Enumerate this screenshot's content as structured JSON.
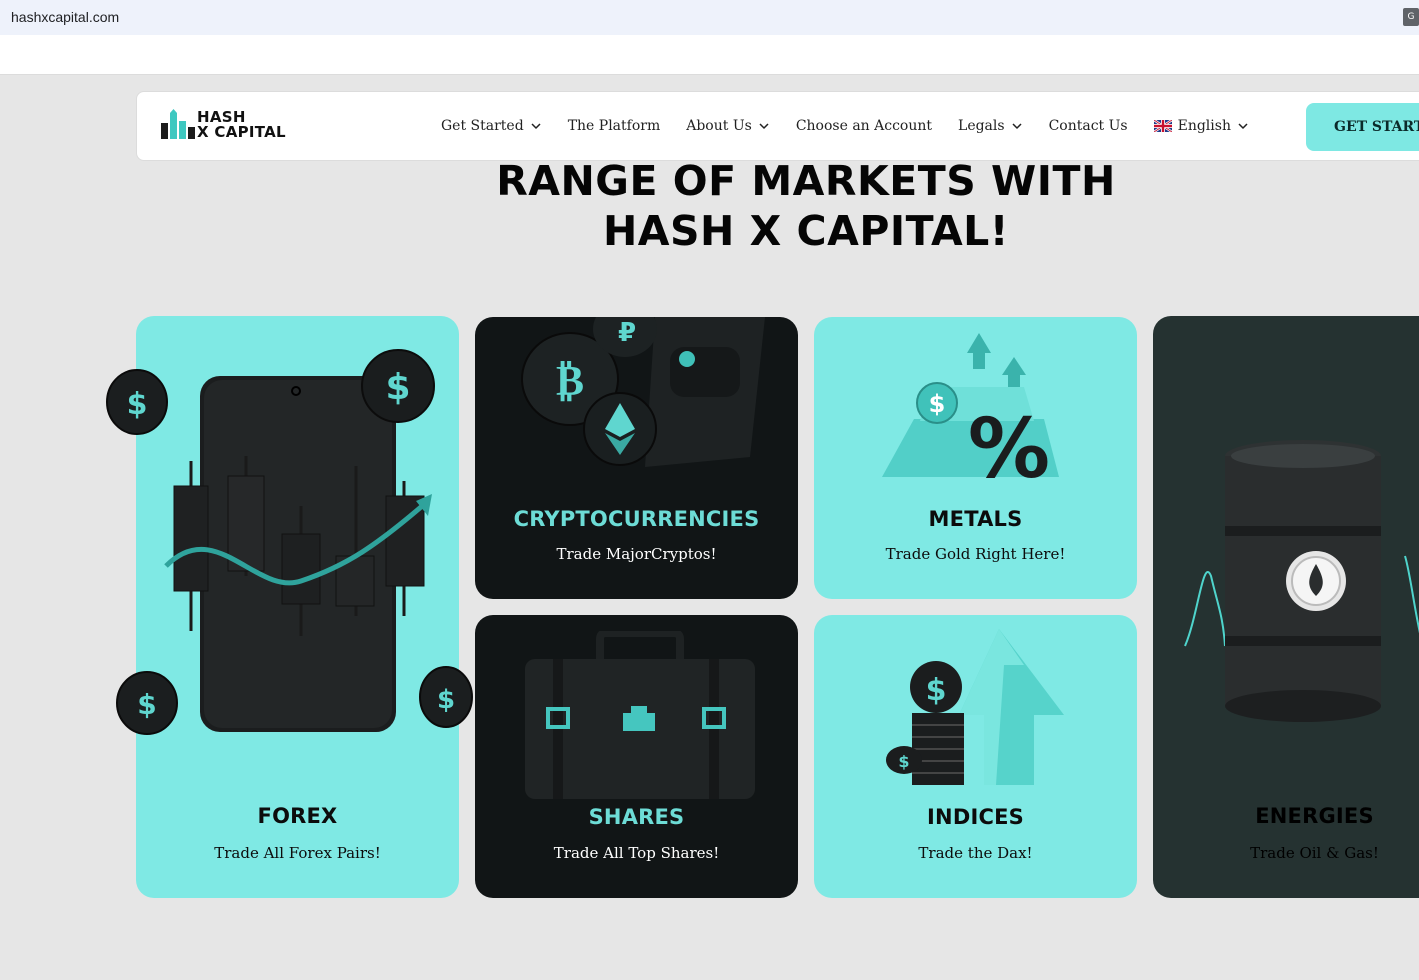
{
  "browser": {
    "url": "hashxcapital.com"
  },
  "header": {
    "logo_line1": "HASH",
    "logo_line2": "X CAPITAL",
    "nav": [
      {
        "label": "Get Started",
        "dropdown": true
      },
      {
        "label": "The Platform",
        "dropdown": false
      },
      {
        "label": "About Us",
        "dropdown": true
      },
      {
        "label": "Choose an Account",
        "dropdown": false
      },
      {
        "label": "Legals",
        "dropdown": true
      },
      {
        "label": "Contact Us",
        "dropdown": false
      }
    ],
    "language": "English",
    "cta": "GET STARTED"
  },
  "hero": {
    "line1": "RANGE OF MARKETS WITH",
    "line2": "HASH X CAPITAL!"
  },
  "markets": {
    "forex": {
      "title": "FOREX",
      "subtitle": "Trade All Forex Pairs!"
    },
    "crypto": {
      "title": "CRYPTOCURRENCIES",
      "subtitle": "Trade MajorCryptos!"
    },
    "metals": {
      "title": "METALS",
      "subtitle": "Trade Gold Right Here!"
    },
    "shares": {
      "title": "SHARES",
      "subtitle": "Trade All Top Shares!"
    },
    "indices": {
      "title": "INDICES",
      "subtitle": "Trade the Dax!"
    },
    "energies": {
      "title": "ENERGIES",
      "subtitle": "Trade Oil & Gas!"
    }
  },
  "colors": {
    "accent": "#7ee8e3",
    "dark_card": "#111516",
    "page_bg": "#e6e6e6"
  }
}
